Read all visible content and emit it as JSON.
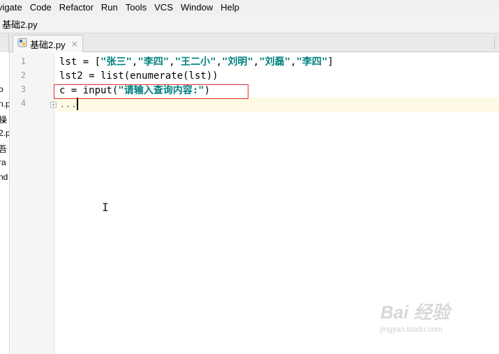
{
  "menu": {
    "items": [
      "vigate",
      "Code",
      "Refactor",
      "Run",
      "Tools",
      "VCS",
      "Window",
      "Help"
    ]
  },
  "navbar": {
    "breadcrumb": "基础2.py"
  },
  "tabs": [
    {
      "label": "基础2.py",
      "close": "×"
    }
  ],
  "project_panel": {
    "items": [
      "o",
      "n.p",
      "操",
      "2.p",
      "吾",
      "ra",
      "nd"
    ]
  },
  "editor": {
    "line_numbers": [
      "1",
      "2",
      "3",
      "4"
    ],
    "lines": {
      "l1_prefix": "lst = [",
      "l1_s1": "\"张三\"",
      "l1_s2": "\"李四\"",
      "l1_s3": "\"王二小\"",
      "l1_s4": "\"刘明\"",
      "l1_s5": "\"刘磊\"",
      "l1_s6": "\"李四\"",
      "l1_comma": ",",
      "l1_suffix": "]",
      "l2": "lst2 = list(enumerate(lst))",
      "l3_prefix": "c = input(",
      "l3_str": "\"请输入查询内容:\"",
      "l3_suffix": ")",
      "l4": "..."
    }
  },
  "watermark": {
    "logo": "Bai 经验",
    "url": "jingyan.baidu.com"
  }
}
